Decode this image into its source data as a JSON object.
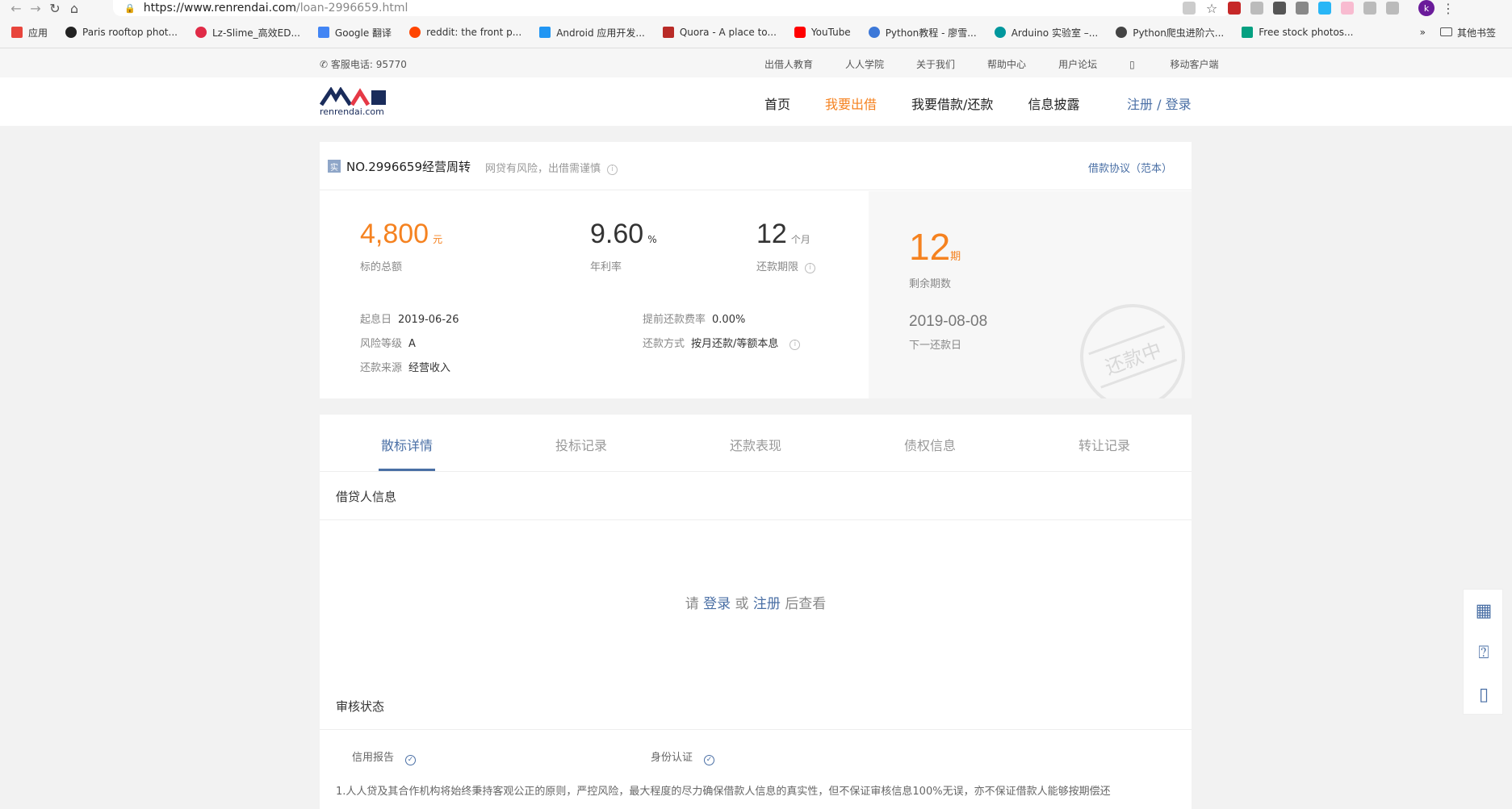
{
  "browser": {
    "url_host": "https://www.renrendai.com",
    "url_path": "/loan-2996659.html",
    "avatar_letter": "k",
    "bookmarks": [
      {
        "label": "应用",
        "color": "#e8453c"
      },
      {
        "label": "Paris rooftop phot...",
        "color": "#222222"
      },
      {
        "label": "Lz-Slime_高效ED...",
        "color": "#e02b47"
      },
      {
        "label": "Google 翻译",
        "color": "#4285f4"
      },
      {
        "label": "reddit: the front p...",
        "color": "#ff4500"
      },
      {
        "label": "Android 应用开发...",
        "color": "#2196f3"
      },
      {
        "label": "Quora - A place to...",
        "color": "#b92b27"
      },
      {
        "label": "YouTube",
        "color": "#ff0000"
      },
      {
        "label": "Python教程 - 廖雪...",
        "color": "#3c78d8"
      },
      {
        "label": "Arduino 实验室 –...",
        "color": "#00979d"
      },
      {
        "label": "Python爬虫进阶六...",
        "color": "#444444"
      },
      {
        "label": "Free stock photos...",
        "color": "#05a081"
      }
    ],
    "more_label": "»",
    "other_bookmarks": "其他书签"
  },
  "site": {
    "phone": "客服电话: 95770",
    "top_links": [
      "出借人教育",
      "人人学院",
      "关于我们",
      "帮助中心",
      "用户论坛",
      "移动客户端"
    ],
    "logo_sub": "renrendai.com",
    "nav": [
      {
        "label": "首页",
        "active": false
      },
      {
        "label": "我要出借",
        "active": true
      },
      {
        "label": "我要借款/还款",
        "active": false
      },
      {
        "label": "信息披露",
        "active": false
      }
    ],
    "login": "注册 / 登录"
  },
  "loan": {
    "badge": "实",
    "title": "NO.2996659经营周转",
    "risk_note": "网贷有风险，出借需谨慎",
    "agreement": "借款协议（范本）",
    "amount": {
      "value": "4,800",
      "unit": "元",
      "label": "标的总额"
    },
    "rate": {
      "value": "9.60",
      "unit": "%",
      "label": "年利率"
    },
    "term": {
      "value": "12",
      "unit": "个月",
      "label": "还款期限"
    },
    "details": {
      "start_label": "起息日",
      "start_value": "2019-06-26",
      "risk_label": "风险等级",
      "risk_value": "A",
      "source_label": "还款来源",
      "source_value": "经营收入",
      "prepay_label": "提前还款费率",
      "prepay_value": "0.00%",
      "method_label": "还款方式",
      "method_value": "按月还款/等额本息"
    },
    "remaining": {
      "value": "12",
      "unit": "期",
      "label": "剩余期数"
    },
    "next_date": "2019-08-08",
    "next_label": "下一还款日",
    "stamp": "还款中"
  },
  "tabs": [
    "散标详情",
    "投标记录",
    "还款表现",
    "债权信息",
    "转让记录"
  ],
  "panel": {
    "borrower_title": "借贷人信息",
    "prompt_pre": "请",
    "prompt_login": "登录",
    "prompt_or": "或",
    "prompt_register": "注册",
    "prompt_post": "后查看",
    "audit_title": "审核状态",
    "audit_items": [
      "信用报告",
      "身份认证"
    ],
    "disclaimer": "1.人人贷及其合作机构将始终秉持客观公正的原则，严控风险，最大程度的尽力确保借款人信息的真实性，但不保证审核信息100%无误，亦不保证借款人能够按期偿还"
  },
  "colors": {
    "accent": "#f58220",
    "link": "#4a6fa5"
  }
}
